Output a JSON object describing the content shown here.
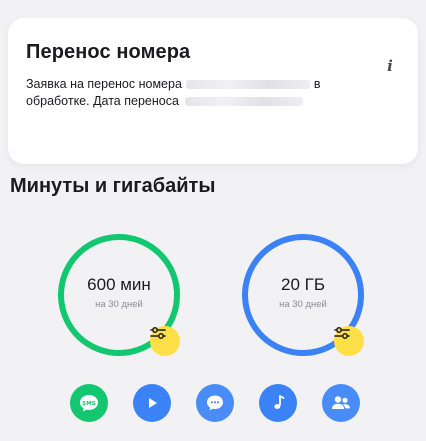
{
  "transfer_card": {
    "title": "Перенос номера",
    "info_icon": "info-icon",
    "text_part1": "Заявка на перенос номера",
    "text_part2": "в обработке. Дата переноса"
  },
  "section": {
    "title": "Минуты и гигабайты"
  },
  "packages": [
    {
      "value": "600 мин",
      "period": "на 30 дней",
      "color": "#12c76f",
      "level": 0.95,
      "adjust_icon": "sliders-icon"
    },
    {
      "value": "20 ГБ",
      "period": "на 30 дней",
      "color": "#3b82f6",
      "level": 0.95,
      "adjust_icon": "sliders-icon"
    }
  ],
  "colors": {
    "accent_yellow": "#fde047",
    "green": "#12c76f",
    "blue": "#3b82f6",
    "blue_light": "#4a8cf7",
    "purple": "#8b5cf6"
  },
  "service_icons": [
    {
      "name": "sms-icon",
      "color": "#12c76f"
    },
    {
      "name": "play-icon",
      "color": "#3b82f6"
    },
    {
      "name": "chat-icon",
      "color": "#4a8cf7"
    },
    {
      "name": "music-icon",
      "color": "#3b82f6"
    },
    {
      "name": "people-icon",
      "color": "#4a8cf7"
    }
  ]
}
